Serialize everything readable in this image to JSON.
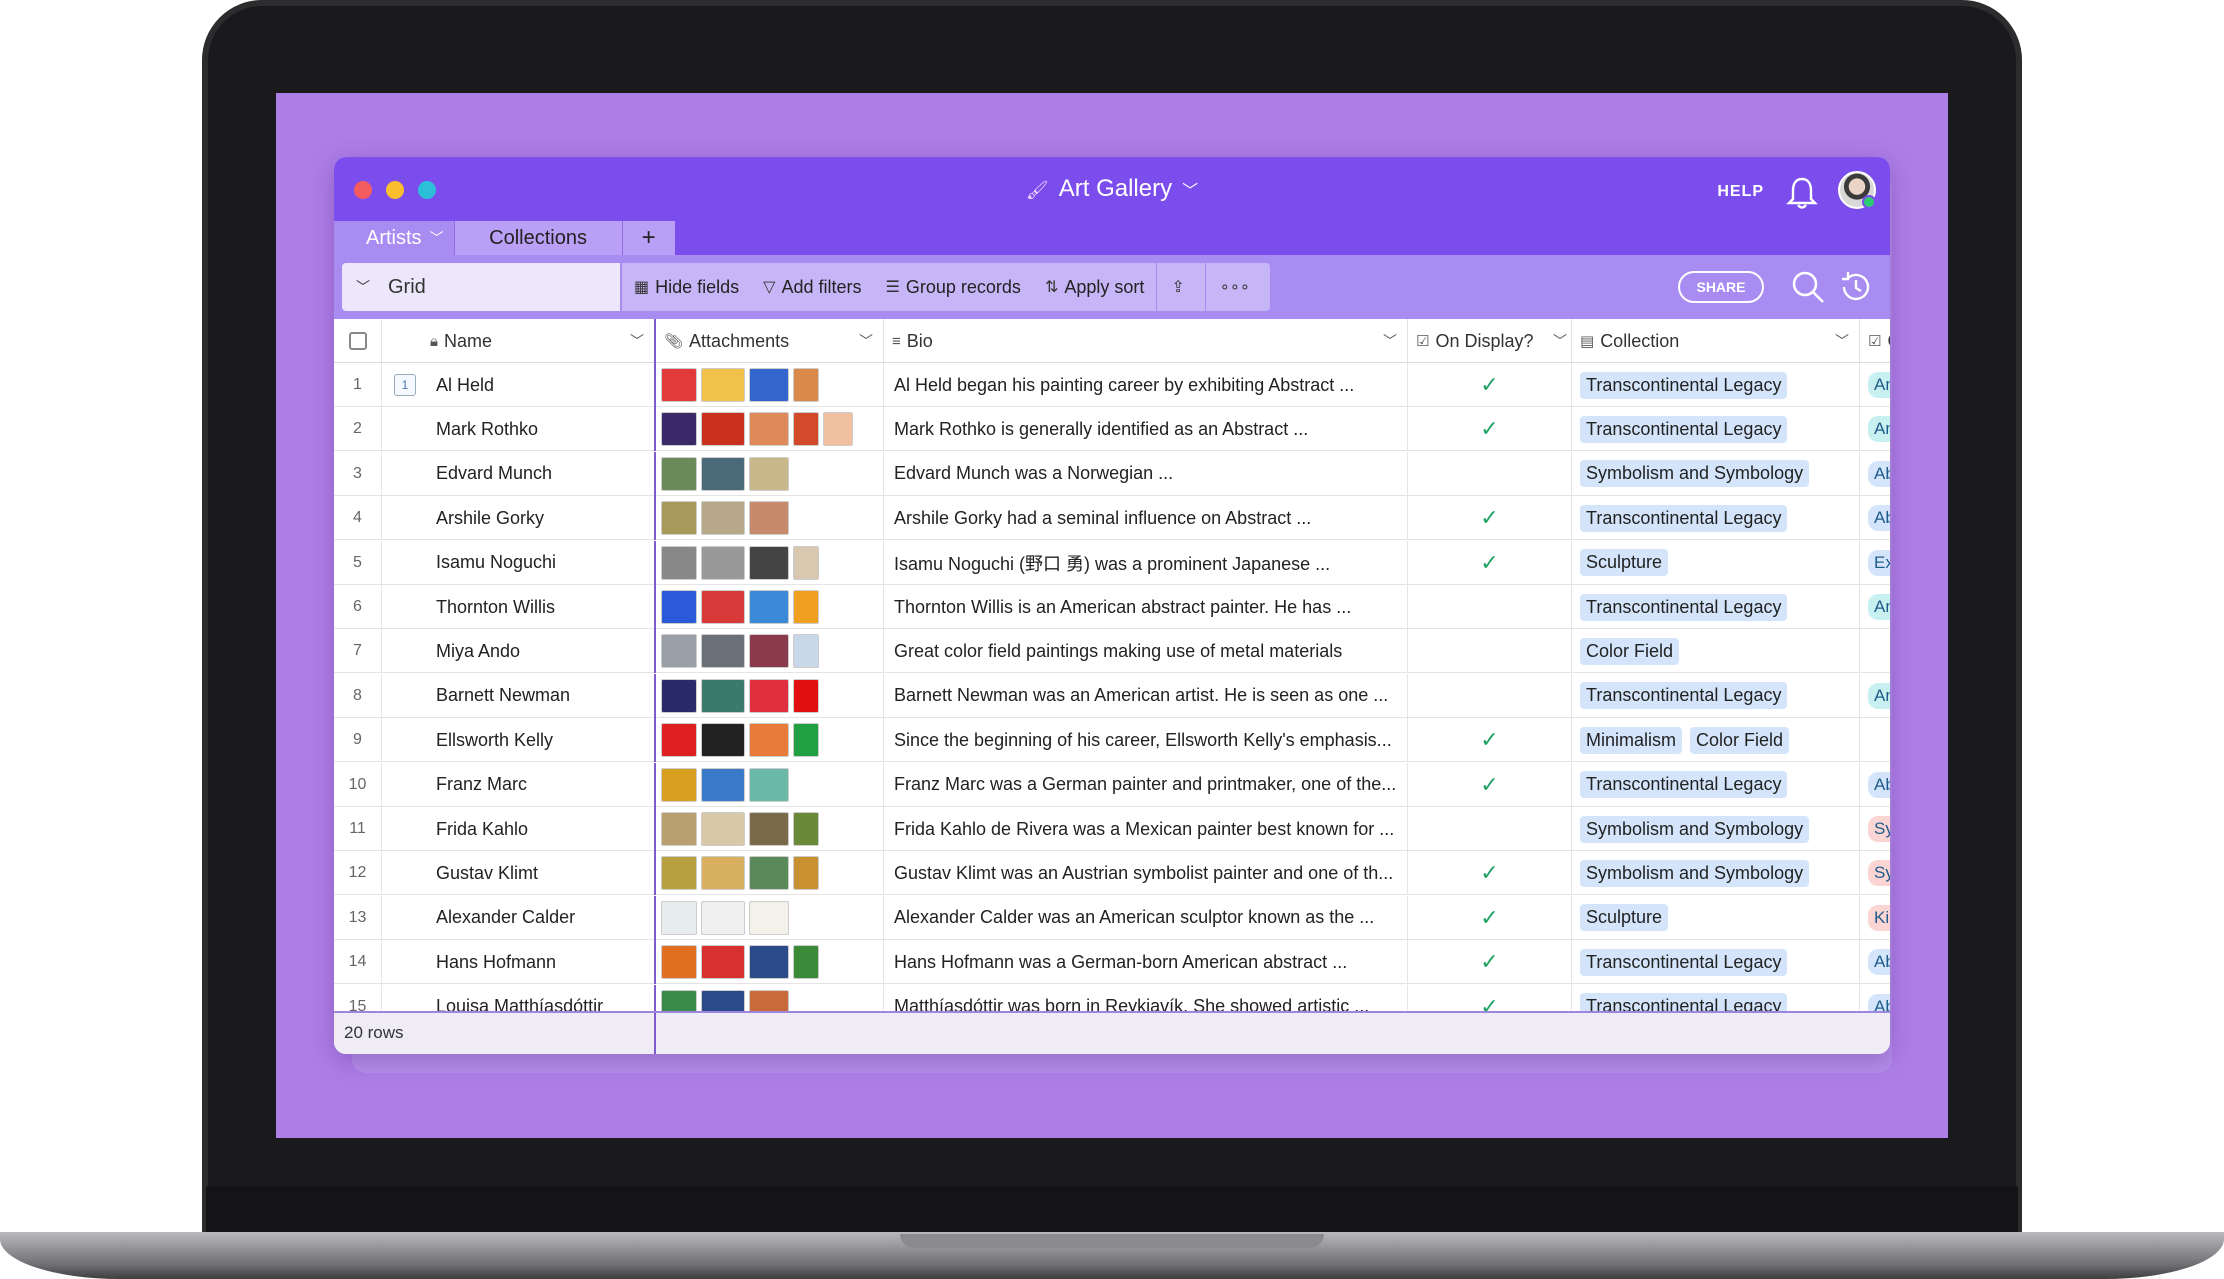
{
  "app": {
    "title": "Art Gallery",
    "help_label": "HELP",
    "share_label": "SHARE"
  },
  "tabs": [
    {
      "label": "Artists"
    },
    {
      "label": "Collections"
    },
    {
      "label": "+"
    }
  ],
  "toolbar": {
    "view_label": "Grid",
    "hide_fields": "Hide fields",
    "add_filters": "Add filters",
    "group_records": "Group records",
    "apply_sort": "Apply sort"
  },
  "columns": {
    "name": "Name",
    "attachments": "Attachments",
    "bio": "Bio",
    "on_display": "On Display?",
    "collection": "Collection",
    "g": "G"
  },
  "rows": [
    {
      "num": "1",
      "name": "Al Held",
      "bio": "Al Held began his painting career by exhibiting Abstract ...",
      "on_display": true,
      "collection": [
        "Transcontinental Legacy"
      ],
      "g": {
        "text": "Am",
        "color": "#c9f0f0"
      },
      "thumbs": [
        "#e23a3a",
        "#f2c14a",
        "#3366cc",
        "#d98a4a"
      ]
    },
    {
      "num": "2",
      "name": "Mark Rothko",
      "bio": "Mark Rothko is generally identified as an Abstract ...",
      "on_display": true,
      "collection": [
        "Transcontinental Legacy"
      ],
      "g": {
        "text": "Am",
        "color": "#c9f0f0"
      },
      "thumbs": [
        "#3a2a6a",
        "#c9301e",
        "#e08a5a",
        "#d24a2a",
        "#f0c0a0"
      ]
    },
    {
      "num": "3",
      "name": "Edvard Munch",
      "bio": "Edvard Munch was a Norwegian ...",
      "on_display": false,
      "collection": [
        "Symbolism and Symbology"
      ],
      "g": {
        "text": "Abs",
        "color": "#d4e5fb"
      },
      "thumbs": [
        "#6a8a5a",
        "#4a6a7a",
        "#c9b88a"
      ]
    },
    {
      "num": "4",
      "name": "Arshile Gorky",
      "bio": "Arshile Gorky had a seminal influence on Abstract ...",
      "on_display": true,
      "collection": [
        "Transcontinental Legacy"
      ],
      "g": {
        "text": "Abs",
        "color": "#d4e5fb"
      },
      "thumbs": [
        "#a89a5a",
        "#b8a88a",
        "#c78a6a"
      ]
    },
    {
      "num": "5",
      "name": "Isamu Noguchi",
      "bio": "Isamu Noguchi (野口 勇) was a prominent Japanese ...",
      "on_display": true,
      "collection": [
        "Sculpture"
      ],
      "g": {
        "text": "Exp",
        "color": "#d4e5fb"
      },
      "thumbs": [
        "#888888",
        "#999999",
        "#444444",
        "#d8c8b0"
      ]
    },
    {
      "num": "6",
      "name": "Thornton Willis",
      "bio": "Thornton Willis is an American abstract painter. He has ...",
      "on_display": false,
      "collection": [
        "Transcontinental Legacy"
      ],
      "g": {
        "text": "Am",
        "color": "#c9f0f0"
      },
      "thumbs": [
        "#2a5ad8",
        "#d83a3a",
        "#3a8ad8",
        "#f0a020"
      ]
    },
    {
      "num": "7",
      "name": "Miya Ando",
      "bio": "Great color field paintings making use of metal materials",
      "on_display": false,
      "collection": [
        "Color Field"
      ],
      "g": {
        "text": "",
        "color": "#ffffff"
      },
      "thumbs": [
        "#9aa0a8",
        "#6a7078",
        "#8a3a4a",
        "#c8d8e8"
      ]
    },
    {
      "num": "8",
      "name": "Barnett Newman",
      "bio": "Barnett Newman was an American artist. He is seen as one ...",
      "on_display": false,
      "collection": [
        "Transcontinental Legacy"
      ],
      "g": {
        "text": "Am",
        "color": "#c9f0f0"
      },
      "thumbs": [
        "#2a2a6a",
        "#3a7a6a",
        "#e03040",
        "#e01010"
      ]
    },
    {
      "num": "9",
      "name": "Ellsworth Kelly",
      "bio": "Since the beginning of his career, Ellsworth Kelly's emphasis...",
      "on_display": true,
      "collection": [
        "Minimalism",
        "Color Field"
      ],
      "g": {
        "text": "",
        "color": "#ffffff"
      },
      "thumbs": [
        "#e02020",
        "#222222",
        "#e87a3a",
        "#20a040"
      ]
    },
    {
      "num": "10",
      "name": "Franz Marc",
      "bio": "Franz Marc was a German painter and printmaker, one of the...",
      "on_display": true,
      "collection": [
        "Transcontinental Legacy"
      ],
      "g": {
        "text": "Abs",
        "color": "#d4e5fb"
      },
      "thumbs": [
        "#d8a020",
        "#3a7ac8",
        "#6ab8a8"
      ]
    },
    {
      "num": "11",
      "name": "Frida Kahlo",
      "bio": "Frida Kahlo de Rivera was a Mexican painter best known for ...",
      "on_display": false,
      "collection": [
        "Symbolism and Symbology"
      ],
      "g": {
        "text": "Syr",
        "color": "#fbd4d4"
      },
      "thumbs": [
        "#b8a070",
        "#d8c8a8",
        "#7a6a4a",
        "#6a8a3a"
      ]
    },
    {
      "num": "12",
      "name": "Gustav Klimt",
      "bio": "Gustav Klimt was an Austrian symbolist painter and one of th...",
      "on_display": true,
      "collection": [
        "Symbolism and Symbology"
      ],
      "g": {
        "text": "Syr",
        "color": "#fbd4d4"
      },
      "thumbs": [
        "#b8a040",
        "#d8b060",
        "#5a8a5a",
        "#c89030"
      ]
    },
    {
      "num": "13",
      "name": "Alexander Calder",
      "bio": "Alexander Calder was an American sculptor known as the ...",
      "on_display": true,
      "collection": [
        "Sculpture"
      ],
      "g": {
        "text": "Kin",
        "color": "#fbd4d4"
      },
      "thumbs": [
        "#e8eef0",
        "#f0f0f0",
        "#f4f0ea"
      ]
    },
    {
      "num": "14",
      "name": "Hans Hofmann",
      "bio": "Hans Hofmann was a German-born American abstract ...",
      "on_display": true,
      "collection": [
        "Transcontinental Legacy"
      ],
      "g": {
        "text": "Abs",
        "color": "#d4e5fb"
      },
      "thumbs": [
        "#e07020",
        "#d83030",
        "#2a4a8a",
        "#3a8a3a"
      ]
    },
    {
      "num": "15",
      "name": "Louisa Matthíasdóttir",
      "bio": "Matthíasdóttir was born in Reykjavík. She showed artistic ...",
      "on_display": true,
      "collection": [
        "Transcontinental Legacy"
      ],
      "g": {
        "text": "Abs",
        "color": "#d4e5fb"
      },
      "thumbs": [
        "#3a8a4a",
        "#2a4a8a",
        "#c86a3a"
      ]
    }
  ],
  "footer": {
    "row_count": "20 rows"
  }
}
